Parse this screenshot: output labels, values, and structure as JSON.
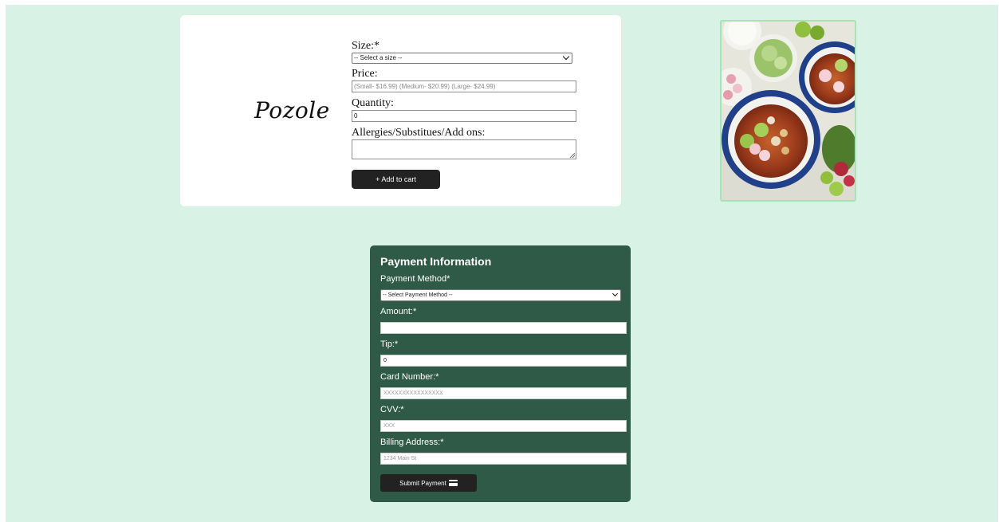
{
  "product": {
    "name": "Pozole",
    "size": {
      "label": "Size:*",
      "selected": "-- Select a size --"
    },
    "price": {
      "label": "Price:",
      "placeholder": "(Small- $16.99) (Medium- $20.99) (Large- $24.99)"
    },
    "quantity": {
      "label": "Quantity:",
      "value": "0"
    },
    "notes": {
      "label": "Allergies/Substitues/Add ons:",
      "value": ""
    },
    "add_to_cart": {
      "icon": "plus-icon",
      "label": "+ Add to cart"
    }
  },
  "photo": {
    "icon": "pozole-photo",
    "colors": {
      "border": "#a6e3b5"
    }
  },
  "payment": {
    "title": "Payment Information",
    "method": {
      "label": "Payment Method*",
      "selected": "-- Select Payment Method --"
    },
    "amount": {
      "label": "Amount:*",
      "value": ""
    },
    "tip": {
      "label": "Tip:*",
      "value": "0"
    },
    "card_number": {
      "label": "Card Number:*",
      "placeholder": "XXXXXXXXXXXXXXXX"
    },
    "cvv": {
      "label": "CVV:*",
      "placeholder": "XXX"
    },
    "billing": {
      "label": "Billing Address:*",
      "placeholder": "1234 Main St"
    },
    "submit": {
      "label": "Submit Payment",
      "icon": "credit-card-icon"
    }
  },
  "colors": {
    "page_background": "#d8f3e5",
    "payment_card": "#2f5a48",
    "button": "#222222"
  }
}
